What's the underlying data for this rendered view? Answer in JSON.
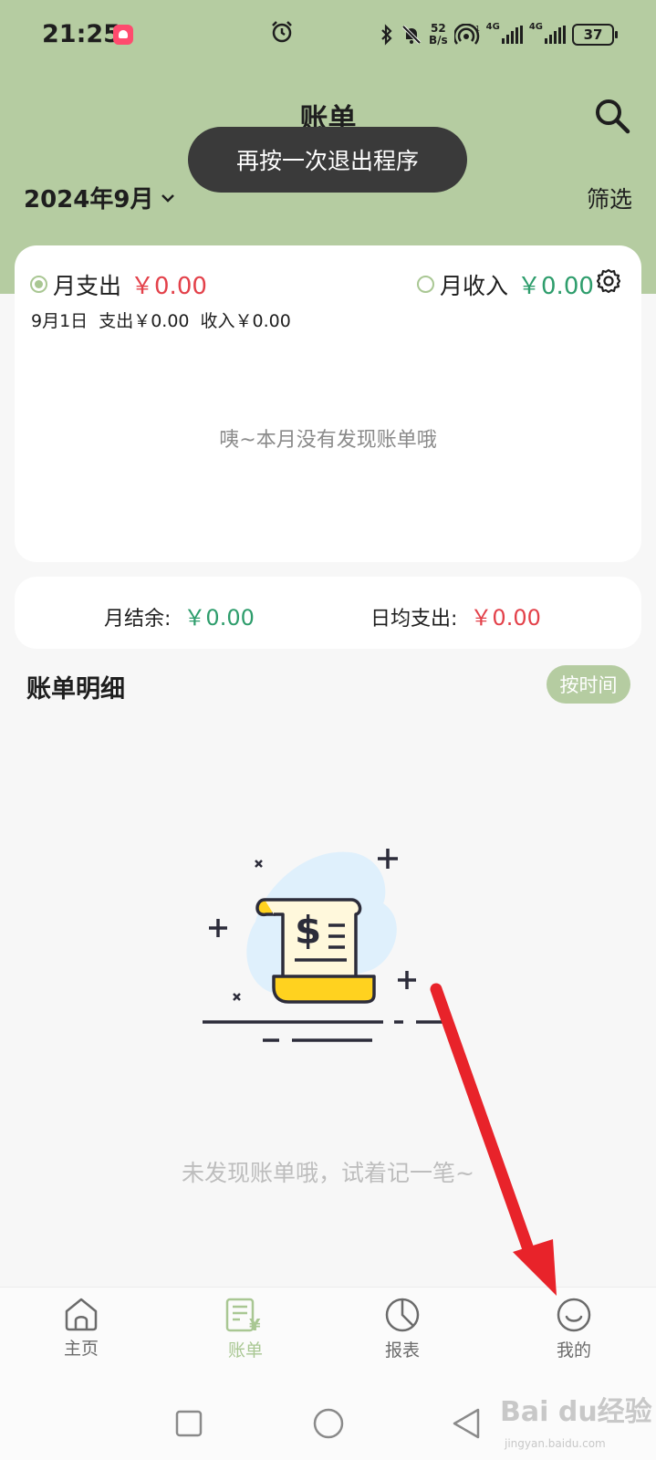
{
  "status_bar": {
    "time": "21:25",
    "net_speed_value": "52",
    "net_speed_unit": "B/s",
    "sim1_label": "4G",
    "sim2_label": "4G",
    "battery": "37"
  },
  "header": {
    "title": "账单",
    "month": "2024年9月",
    "filter_label": "筛选"
  },
  "toast": {
    "text": "再按一次退出程序"
  },
  "summary": {
    "expense_label": "月支出",
    "expense_amount": "￥0.00",
    "expense_selected": true,
    "income_label": "月收入",
    "income_amount": "￥0.00",
    "income_selected": false,
    "daily_date": "9月1日",
    "daily_expense": "支出￥0.00",
    "daily_income": "收入￥0.00",
    "empty_text": "咦~本月没有发现账单哦"
  },
  "balance": {
    "remaining_label": "月结余:",
    "remaining_value": "￥0.00",
    "daily_avg_label": "日均支出:",
    "daily_avg_value": "￥0.00"
  },
  "details": {
    "title": "账单明细",
    "sort_label": "按时间",
    "empty_hint": "未发现账单哦，试着记一笔~"
  },
  "bottom_nav": {
    "items": [
      {
        "label": "主页",
        "icon": "home-icon",
        "active": false
      },
      {
        "label": "账单",
        "icon": "bill-icon",
        "active": true
      },
      {
        "label": "报表",
        "icon": "pie-chart-icon",
        "active": false
      },
      {
        "label": "我的",
        "icon": "smile-icon",
        "active": false
      }
    ]
  },
  "colors": {
    "header_bg": "#b5cca1",
    "accent": "#a9c793",
    "expense": "#e3414a",
    "income": "#2e9d6c",
    "annotation_arrow": "#e8232a"
  },
  "watermark": {
    "main": "Bai du经验",
    "sub": "jingyan.baidu.com"
  }
}
